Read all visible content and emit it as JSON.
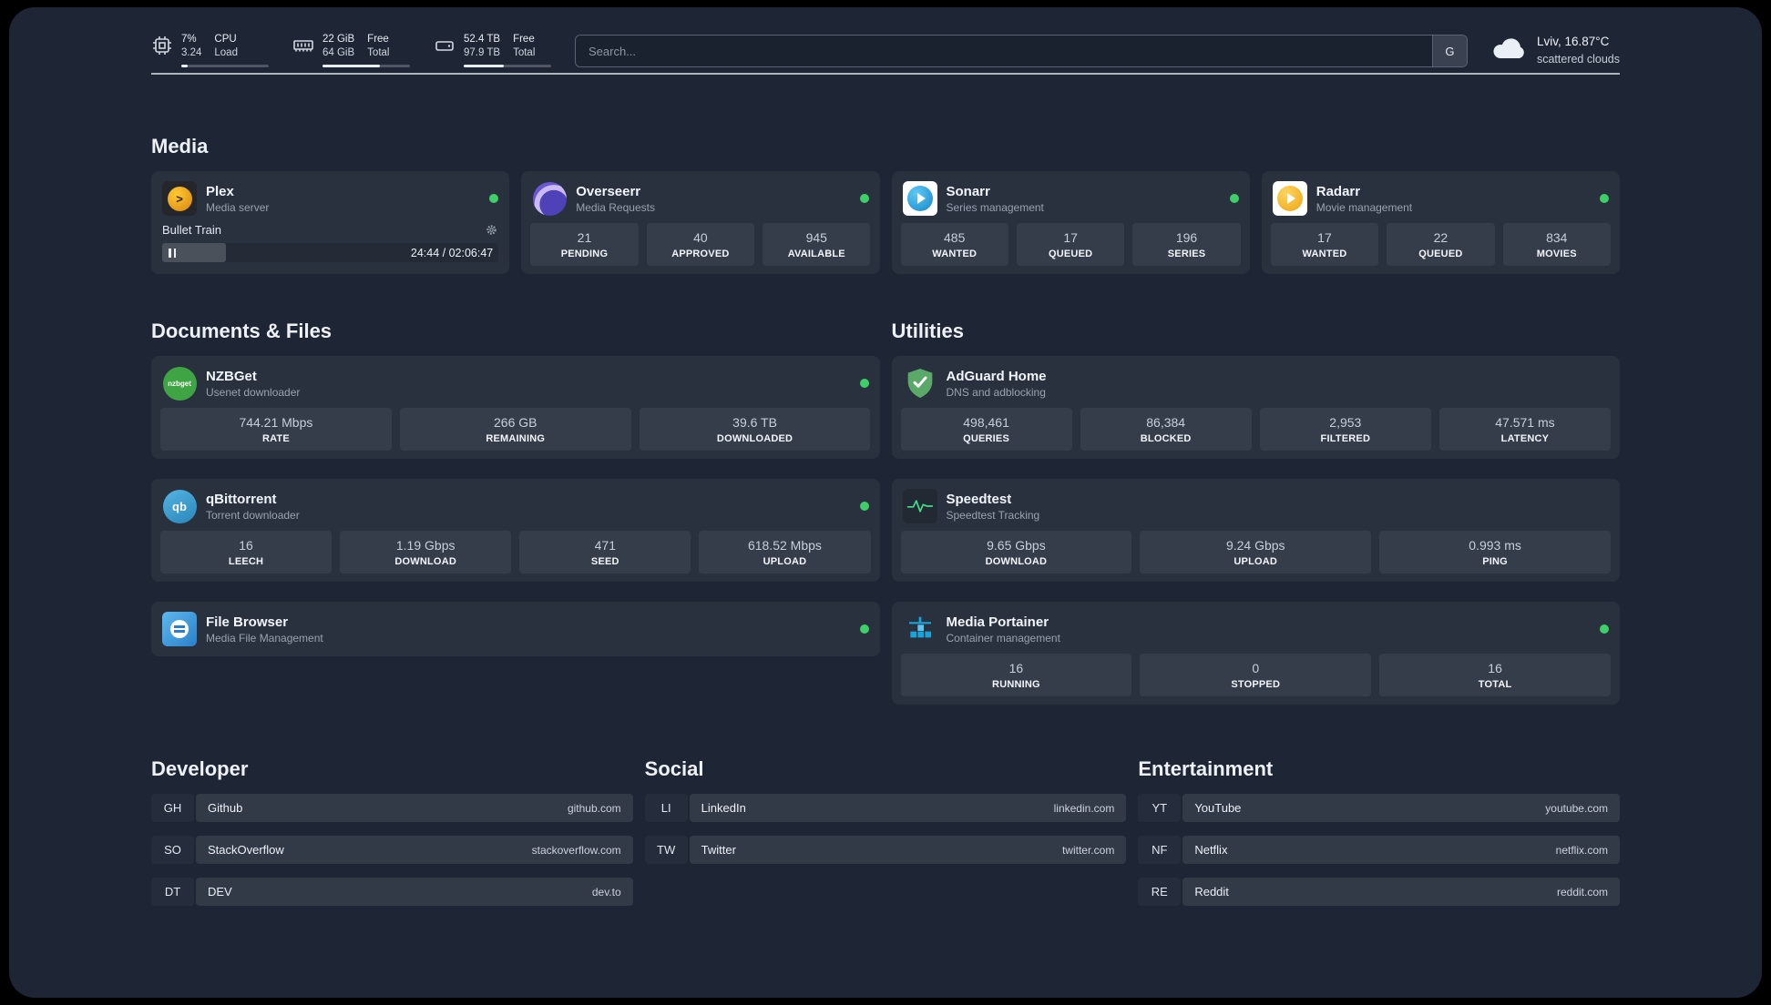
{
  "topbar": {
    "resources": [
      {
        "name": "cpu",
        "value_top": "7%",
        "value_bottom": "3.24",
        "label_top": "CPU",
        "label_bottom": "Load",
        "percent": 7
      },
      {
        "name": "memory",
        "value_top": "22 GiB",
        "value_bottom": "64 GiB",
        "label_top": "Free",
        "label_bottom": "Total",
        "percent": 66
      },
      {
        "name": "disk",
        "value_top": "52.4 TB",
        "value_bottom": "97.9 TB",
        "label_top": "Free",
        "label_bottom": "Total",
        "percent": 46
      }
    ],
    "search": {
      "placeholder": "Search...",
      "provider_label": "G"
    },
    "weather": {
      "location": "Lviv, 16.87°C",
      "condition": "scattered clouds"
    }
  },
  "sections": {
    "media": {
      "title": "Media"
    },
    "documents": {
      "title": "Documents & Files"
    },
    "utilities": {
      "title": "Utilities"
    },
    "developer": {
      "title": "Developer"
    },
    "social": {
      "title": "Social"
    },
    "entertainment": {
      "title": "Entertainment"
    }
  },
  "services": {
    "plex": {
      "name": "Plex",
      "subtitle": "Media server",
      "player": {
        "track": "Bullet Train",
        "time": "24:44 / 02:06:47",
        "progress_percent": 19
      }
    },
    "overseerr": {
      "name": "Overseerr",
      "subtitle": "Media Requests",
      "stats": [
        {
          "value": "21",
          "label": "PENDING"
        },
        {
          "value": "40",
          "label": "APPROVED"
        },
        {
          "value": "945",
          "label": "AVAILABLE"
        }
      ]
    },
    "sonarr": {
      "name": "Sonarr",
      "subtitle": "Series management",
      "stats": [
        {
          "value": "485",
          "label": "WANTED"
        },
        {
          "value": "17",
          "label": "QUEUED"
        },
        {
          "value": "196",
          "label": "SERIES"
        }
      ]
    },
    "radarr": {
      "name": "Radarr",
      "subtitle": "Movie management",
      "stats": [
        {
          "value": "17",
          "label": "WANTED"
        },
        {
          "value": "22",
          "label": "QUEUED"
        },
        {
          "value": "834",
          "label": "MOVIES"
        }
      ]
    },
    "nzbget": {
      "name": "NZBGet",
      "subtitle": "Usenet downloader",
      "icon_text": "nzbget",
      "stats": [
        {
          "value": "744.21 Mbps",
          "label": "RATE"
        },
        {
          "value": "266 GB",
          "label": "REMAINING"
        },
        {
          "value": "39.6 TB",
          "label": "DOWNLOADED"
        }
      ]
    },
    "qbittorrent": {
      "name": "qBittorrent",
      "subtitle": "Torrent downloader",
      "icon_text": "qb",
      "stats": [
        {
          "value": "16",
          "label": "LEECH"
        },
        {
          "value": "1.19 Gbps",
          "label": "DOWNLOAD"
        },
        {
          "value": "471",
          "label": "SEED"
        },
        {
          "value": "618.52 Mbps",
          "label": "UPLOAD"
        }
      ]
    },
    "filebrowser": {
      "name": "File Browser",
      "subtitle": "Media File Management"
    },
    "adguard": {
      "name": "AdGuard Home",
      "subtitle": "DNS and adblocking",
      "stats": [
        {
          "value": "498,461",
          "label": "QUERIES"
        },
        {
          "value": "86,384",
          "label": "BLOCKED"
        },
        {
          "value": "2,953",
          "label": "FILTERED"
        },
        {
          "value": "47.571 ms",
          "label": "LATENCY"
        }
      ]
    },
    "speedtest": {
      "name": "Speedtest",
      "subtitle": "Speedtest Tracking",
      "stats": [
        {
          "value": "9.65 Gbps",
          "label": "DOWNLOAD"
        },
        {
          "value": "9.24 Gbps",
          "label": "UPLOAD"
        },
        {
          "value": "0.993 ms",
          "label": "PING"
        }
      ]
    },
    "portainer": {
      "name": "Media Portainer",
      "subtitle": "Container management",
      "stats": [
        {
          "value": "16",
          "label": "RUNNING"
        },
        {
          "value": "0",
          "label": "STOPPED"
        },
        {
          "value": "16",
          "label": "TOTAL"
        }
      ]
    }
  },
  "bookmarks": {
    "developer": [
      {
        "abbr": "GH",
        "name": "Github",
        "url": "github.com"
      },
      {
        "abbr": "SO",
        "name": "StackOverflow",
        "url": "stackoverflow.com"
      },
      {
        "abbr": "DT",
        "name": "DEV",
        "url": "dev.to"
      }
    ],
    "social": [
      {
        "abbr": "LI",
        "name": "LinkedIn",
        "url": "linkedin.com"
      },
      {
        "abbr": "TW",
        "name": "Twitter",
        "url": "twitter.com"
      }
    ],
    "entertainment": [
      {
        "abbr": "YT",
        "name": "YouTube",
        "url": "youtube.com"
      },
      {
        "abbr": "NF",
        "name": "Netflix",
        "url": "netflix.com"
      },
      {
        "abbr": "RE",
        "name": "Reddit",
        "url": "reddit.com"
      }
    ]
  }
}
